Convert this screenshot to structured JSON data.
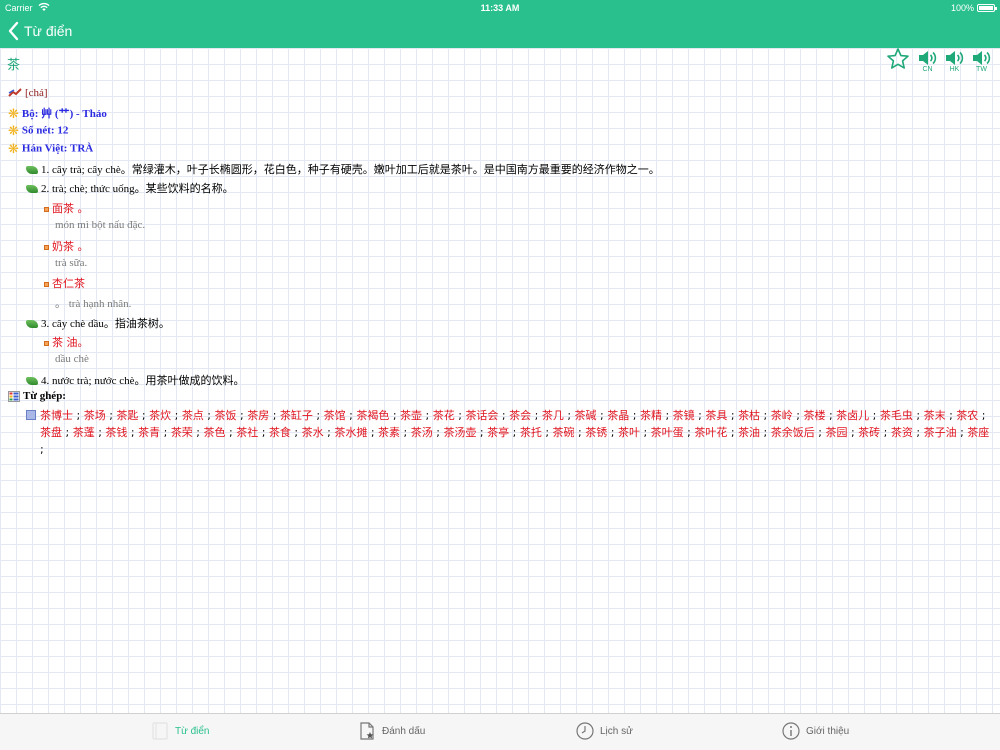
{
  "status_bar": {
    "carrier": "Carrier",
    "time": "11:33 AM",
    "battery": "100%"
  },
  "nav": {
    "back_label": "Từ điển"
  },
  "entry": {
    "headword": "茶",
    "audio": [
      {
        "code": "CN"
      },
      {
        "code": "HK"
      },
      {
        "code": "TW"
      }
    ],
    "pinyin": "[chá]",
    "radical": "Bộ: 艸 (艹) - Thảo",
    "strokes": "Số nét: 12",
    "han_viet": "Hán Việt: TRÀ",
    "senses": [
      {
        "text": "1. cây trà; cây chè。常绿灌木，叶子长椭圆形，花白色，种子有硬壳。嫩叶加工后就是茶叶。是中国南方最重要的经济作物之一。"
      },
      {
        "text": "2. trà; chè; thức uống。某些饮料的名称。",
        "examples": [
          {
            "zh": "面茶 。",
            "vi": "món mì bột nấu đặc."
          },
          {
            "zh": "奶茶 。",
            "vi": "trà sữa."
          },
          {
            "zh": "杏仁茶",
            "vi": "。 trà hạnh nhân."
          }
        ]
      },
      {
        "text": "3. cây chè dầu。指油茶树。",
        "examples": [
          {
            "zh": "茶 油。",
            "vi": "dầu chè"
          }
        ]
      },
      {
        "text": "4. nước trà; nước chè。用茶叶做成的饮料。"
      }
    ],
    "compounds_label": "Từ ghép:",
    "compounds": [
      "茶博士",
      "茶场",
      "茶匙",
      "茶炊",
      "茶点",
      "茶饭",
      "茶房",
      "茶缸子",
      "茶馆",
      "茶褐色",
      "茶壶",
      "茶花",
      "茶话会",
      "茶会",
      "茶几",
      "茶碱",
      "茶晶",
      "茶精",
      "茶镜",
      "茶具",
      "茶枯",
      "茶岭",
      "茶楼",
      "茶卤儿",
      "茶毛虫",
      "茶末",
      "茶农",
      "茶盘",
      "茶蓬",
      "茶钱",
      "茶青",
      "茶荣",
      "茶色",
      "茶社",
      "茶食",
      "茶水",
      "茶水摊",
      "茶素",
      "茶汤",
      "茶汤壶",
      "茶亭",
      "茶托",
      "茶碗",
      "茶锈",
      "茶叶",
      "茶叶蛋",
      "茶叶花",
      "茶油",
      "茶余饭后",
      "茶园",
      "茶砖",
      "茶资",
      "茶子油",
      "茶座"
    ]
  },
  "tabs": [
    {
      "label": "Từ điển",
      "icon": "book-icon",
      "active": true
    },
    {
      "label": "Đánh dấu",
      "icon": "bookmark-star-icon",
      "active": false
    },
    {
      "label": "Lịch sử",
      "icon": "clock-icon",
      "active": false
    },
    {
      "label": "Giới thiệu",
      "icon": "info-icon",
      "active": false
    }
  ],
  "colors": {
    "accent": "#29c08e",
    "compound_red": "#e0141f",
    "info_blue": "#2a2ae0"
  }
}
